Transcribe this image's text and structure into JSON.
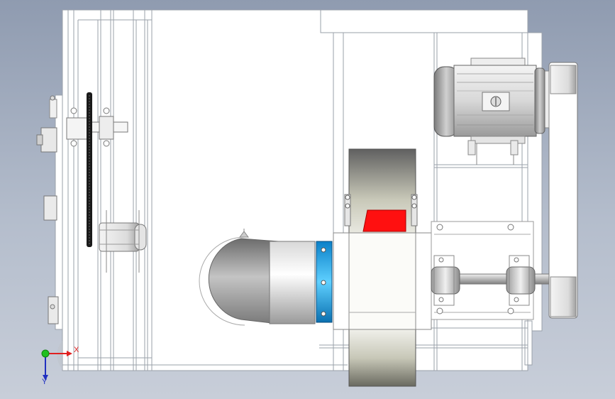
{
  "viewport": {
    "background_top": "#8f9bb0",
    "background_bottom": "#c8ced9"
  },
  "triad": {
    "x_label": "X",
    "y_label": "Y",
    "x_color": "#e02020",
    "y_color": "#2030c0",
    "z_color": "#20c020"
  },
  "colors": {
    "frame_line": "#9aa0aa",
    "fan_blade_accent": "#ff1010",
    "inlet_ring": "#1aa0e0",
    "belt": "#1a1a1a"
  }
}
